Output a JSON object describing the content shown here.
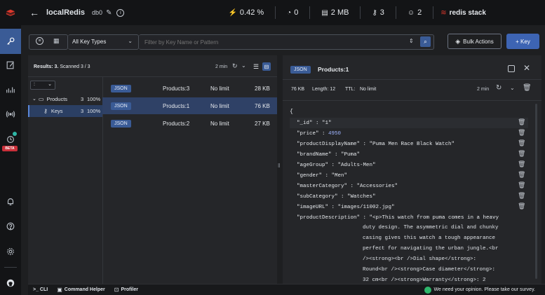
{
  "header": {
    "db_name": "localRedis",
    "db_index": "db0",
    "cpu": "0.42 %",
    "ops": "0",
    "memory": "2 MB",
    "keys": "3",
    "clients": "2",
    "brand": "redis stack"
  },
  "toolbar": {
    "key_type": "All Key Types",
    "filter_placeholder": "Filter by Key Name or Pattern",
    "bulk_actions": "Bulk Actions",
    "add_key": "+ Key"
  },
  "list": {
    "results": "Results: 3.",
    "scanned": "Scanned 3 / 3",
    "refresh_time": "2 min",
    "tree_delim": ":",
    "tree": [
      {
        "label": "Products",
        "count": "3",
        "pct": "100%"
      },
      {
        "label": "Keys",
        "count": "3",
        "pct": "100%"
      }
    ],
    "rows": [
      {
        "type": "JSON",
        "name": "Products:3",
        "ttl": "No limit",
        "size": "28 KB"
      },
      {
        "type": "JSON",
        "name": "Products:1",
        "ttl": "No limit",
        "size": "76 KB"
      },
      {
        "type": "JSON",
        "name": "Products:2",
        "ttl": "No limit",
        "size": "27 KB"
      }
    ]
  },
  "details": {
    "type": "JSON",
    "key": "Products:1",
    "size": "76 KB",
    "length_label": "Length: 12",
    "ttl_label": "TTL:",
    "ttl_value": "No limit",
    "refresh_time": "2 min",
    "open_brace": "{",
    "fields": [
      {
        "key": "\"_id\"",
        "value": "\"1\"",
        "kind": "s"
      },
      {
        "key": "\"price\"",
        "value": "4950",
        "kind": "n"
      },
      {
        "key": "\"productDisplayName\"",
        "value": "\"Puma Men Race Black Watch\"",
        "kind": "s"
      },
      {
        "key": "\"brandName\"",
        "value": "\"Puma\"",
        "kind": "s"
      },
      {
        "key": "\"ageGroup\"",
        "value": "\"Adults-Men\"",
        "kind": "s"
      },
      {
        "key": "\"gender\"",
        "value": "\"Men\"",
        "kind": "s"
      },
      {
        "key": "\"masterCategory\"",
        "value": "\"Accessories\"",
        "kind": "s"
      },
      {
        "key": "\"subCategory\"",
        "value": "\"Watches\"",
        "kind": "s"
      },
      {
        "key": "\"imageURL\"",
        "value": "\"images/11002.jpg\"",
        "kind": "s"
      }
    ],
    "description_key": "\"productDescription\"",
    "description_lines": [
      "\"<p>This watch from puma comes in a heavy",
      "duty design. The asymmetric dial and chunky",
      "casing gives this watch a tough appearance",
      "perfect for navigating the urban jungle.<br",
      "/><strong><br />Dial shape</strong>:",
      "Round<br /><strong>Case diameter</strong>:",
      "32 cm<br /><strong>Warranty</strong>: 2"
    ]
  },
  "footer": {
    "cli": ">_ CLI",
    "helper": "Command Helper",
    "profiler": "Profiler",
    "survey": "We need your opinion. Please take our survey."
  },
  "colors": {
    "accent": "#3a5b96",
    "brand_red": "#dc382c",
    "survey_green": "#2eb66b"
  }
}
